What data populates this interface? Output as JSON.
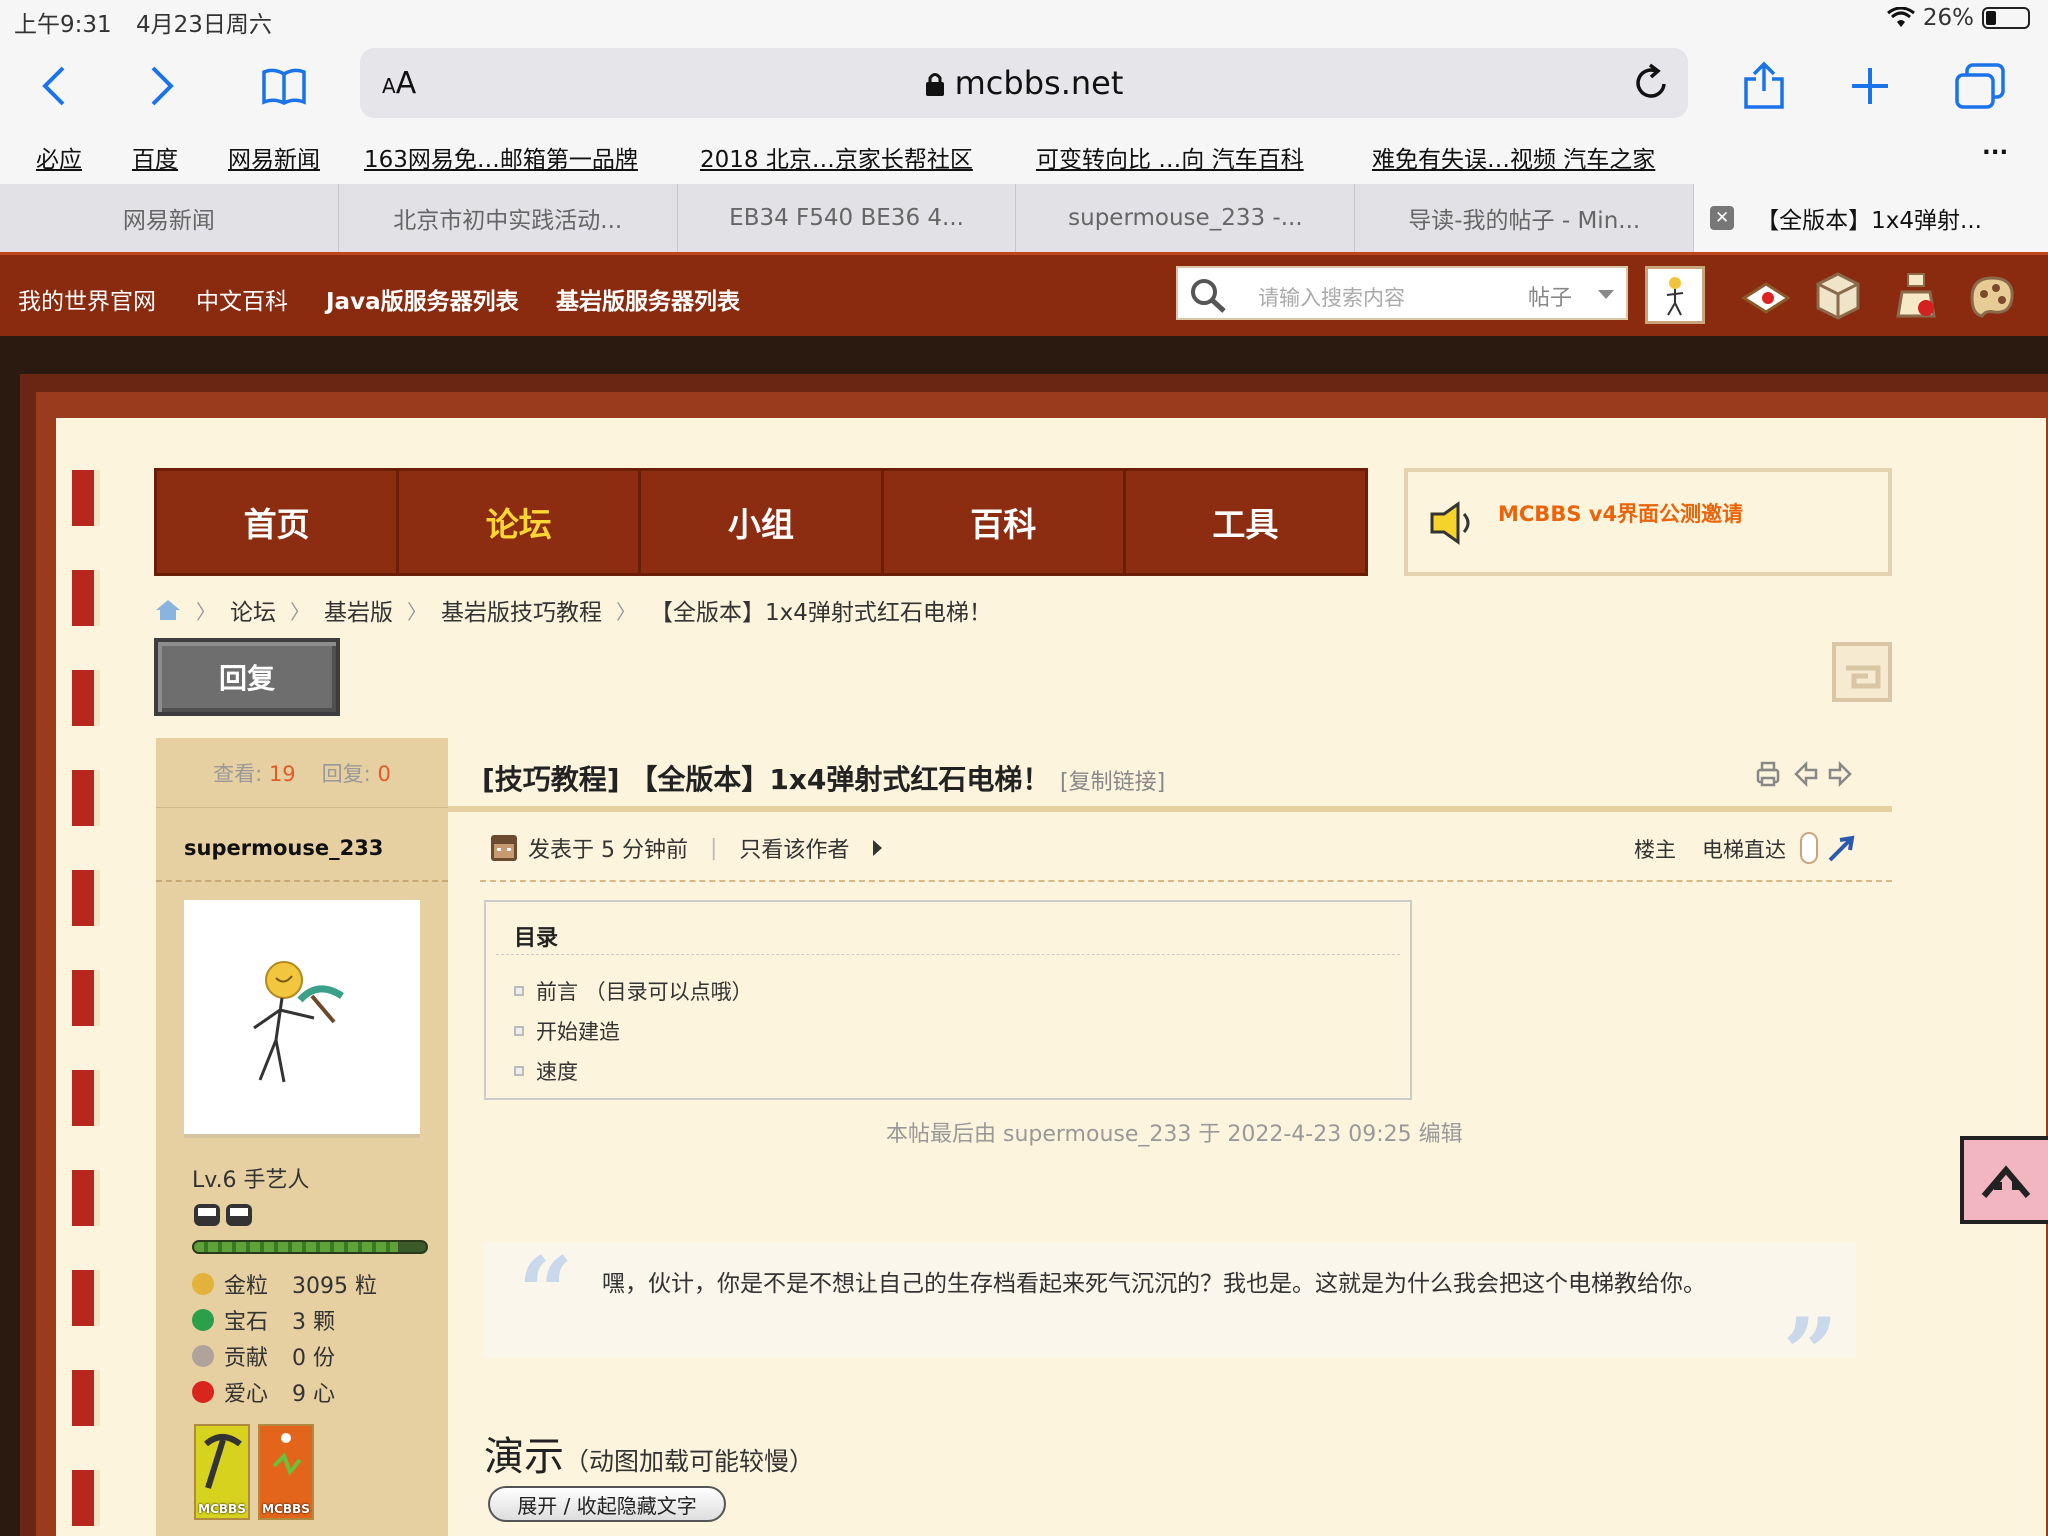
{
  "status": {
    "time": "上午9:31",
    "date": "4月23日周六",
    "battery": "26%"
  },
  "browser": {
    "aa": {
      "small": "A",
      "big": "A"
    },
    "host": "mcbbs.net",
    "bookmarks": [
      "必应",
      "百度",
      "网易新闻",
      "163网易免…邮箱第一品牌",
      "2018 北京…京家长帮社区",
      "可变转向比 …向 汽车百科",
      "难免有失误…视频 汽车之家"
    ],
    "more": "···",
    "tabs": [
      "网易新闻",
      "北京市初中实践活动...",
      "EB34 F540 BE36 4...",
      "supermouse_233 -...",
      "导读-我的帖子 - Min..."
    ],
    "active_tab": "【全版本】1x4弹射...",
    "close_glyph": "✕"
  },
  "site": {
    "links": [
      "我的世界官网",
      "中文百科",
      "Java版服务器列表",
      "基岩版服务器列表"
    ],
    "search_placeholder": "请输入搜索内容",
    "search_type": "帖子",
    "nav": [
      "首页",
      "论坛",
      "小组",
      "百科",
      "工具"
    ],
    "notice": "MCBBS v4界面公测邀请",
    "breadcrumb": [
      "论坛",
      "基岩版",
      "基岩版技巧教程",
      "【全版本】1x4弹射式红石电梯！"
    ],
    "crumb_sep": "〉",
    "reply": "回复"
  },
  "user": {
    "views_label": "查看:",
    "views": "19",
    "replies_label": "回复:",
    "replies": "0",
    "name": "supermouse_233",
    "level": "Lv.6 手艺人",
    "level_progress": 0.88,
    "stats": [
      {
        "label": "金粒",
        "value": "3095 粒",
        "color": "#e2b23a"
      },
      {
        "label": "宝石",
        "value": "3 颗",
        "color": "#2aa04a"
      },
      {
        "label": "贡献",
        "value": "0 份",
        "color": "#b0a49a"
      },
      {
        "label": "爱心",
        "value": "9 心",
        "color": "#d8261c"
      }
    ],
    "medals": [
      "MCBBS",
      "MCBBS"
    ]
  },
  "post": {
    "title": "[技巧教程] 【全版本】1x4弹射式红石电梯！",
    "copy_link": "[复制链接]",
    "posted": "发表于 5 分钟前",
    "author_only": "只看该作者",
    "op": "楼主",
    "elevator": "电梯直达",
    "toc_title": "目录",
    "toc": [
      "前言 （目录可以点哦）",
      "开始建造",
      "速度"
    ],
    "edited": "本帖最后由 supermouse_233 于 2022-4-23 09:25 编辑",
    "quote_open": "“",
    "quote_close": "”",
    "quote": "嘿，伙计，你是不是不想让自己的生存档看起来死气沉沉的？我也是。这就是为什么我会把这个电梯教给你。",
    "demo_title": "演示",
    "demo_note": "（动图加载可能较慢）",
    "toggle": "展开 / 收起隐藏文字"
  }
}
